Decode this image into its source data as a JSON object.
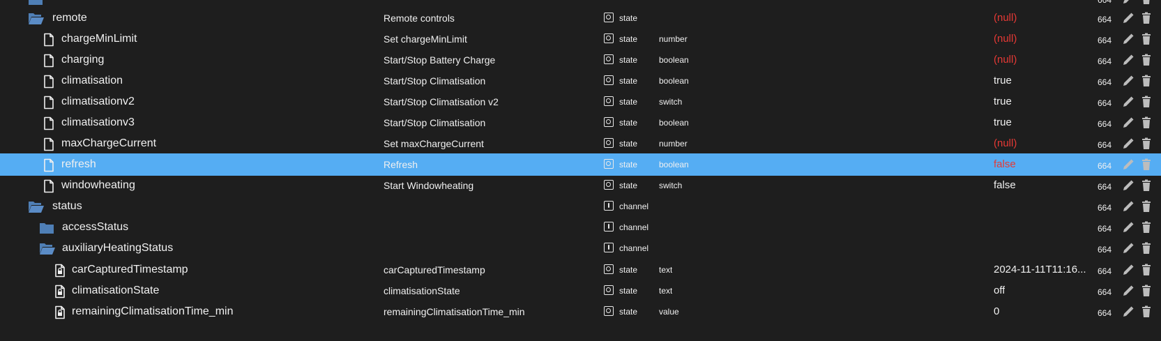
{
  "colors": {
    "background": "#1e1e1e",
    "selected_row": "#55adf3",
    "null_value": "#e53935",
    "folder": "#4f7fb6",
    "text": "#f0f0f0"
  },
  "rows": [
    {
      "name": "",
      "icon": "folder-icon",
      "description": "",
      "type": "",
      "role": "",
      "value": "",
      "acl": "664"
    },
    {
      "name": "remote",
      "icon": "folder-open-icon",
      "description": "Remote controls",
      "type": "state",
      "role": "",
      "value": "(null)",
      "acl": "664"
    },
    {
      "name": "chargeMinLimit",
      "icon": "file-icon",
      "description": "Set chargeMinLimit",
      "type": "state",
      "role": "number",
      "value": "(null)",
      "acl": "664"
    },
    {
      "name": "charging",
      "icon": "file-icon",
      "description": "Start/Stop Battery Charge",
      "type": "state",
      "role": "boolean",
      "value": "(null)",
      "acl": "664"
    },
    {
      "name": "climatisation",
      "icon": "file-icon",
      "description": "Start/Stop Climatisation",
      "type": "state",
      "role": "boolean",
      "value": "true",
      "acl": "664"
    },
    {
      "name": "climatisationv2",
      "icon": "file-icon",
      "description": "Start/Stop Climatisation v2",
      "type": "state",
      "role": "switch",
      "value": "true",
      "acl": "664"
    },
    {
      "name": "climatisationv3",
      "icon": "file-icon",
      "description": "Start/Stop Climatisation",
      "type": "state",
      "role": "boolean",
      "value": "true",
      "acl": "664"
    },
    {
      "name": "maxChargeCurrent",
      "icon": "file-icon",
      "description": "Set maxChargeCurrent",
      "type": "state",
      "role": "number",
      "value": "(null)",
      "acl": "664"
    },
    {
      "name": "refresh",
      "icon": "file-icon",
      "description": "Refresh",
      "type": "state",
      "role": "boolean",
      "value": "false",
      "acl": "664",
      "selected": true
    },
    {
      "name": "windowheating",
      "icon": "file-icon",
      "description": "Start Windowheating",
      "type": "state",
      "role": "switch",
      "value": "false",
      "acl": "664"
    },
    {
      "name": "status",
      "icon": "folder-open-icon",
      "description": "",
      "type": "channel",
      "role": "",
      "value": "",
      "acl": "664"
    },
    {
      "name": "accessStatus",
      "icon": "folder-icon",
      "description": "",
      "type": "channel",
      "role": "",
      "value": "",
      "acl": "664"
    },
    {
      "name": "auxiliaryHeatingStatus",
      "icon": "folder-open-icon",
      "description": "",
      "type": "channel",
      "role": "",
      "value": "",
      "acl": "664"
    },
    {
      "name": "carCapturedTimestamp",
      "icon": "file-lock-icon",
      "description": "carCapturedTimestamp",
      "type": "state",
      "role": "text",
      "value": "2024-11-11T11:16...",
      "acl": "664"
    },
    {
      "name": "climatisationState",
      "icon": "file-lock-icon",
      "description": "climatisationState",
      "type": "state",
      "role": "text",
      "value": "off",
      "acl": "664"
    },
    {
      "name": "remainingClimatisationTime_min",
      "icon": "file-lock-icon",
      "description": "remainingClimatisationTime_min",
      "type": "state",
      "role": "value",
      "value": "0",
      "acl": "664"
    }
  ]
}
